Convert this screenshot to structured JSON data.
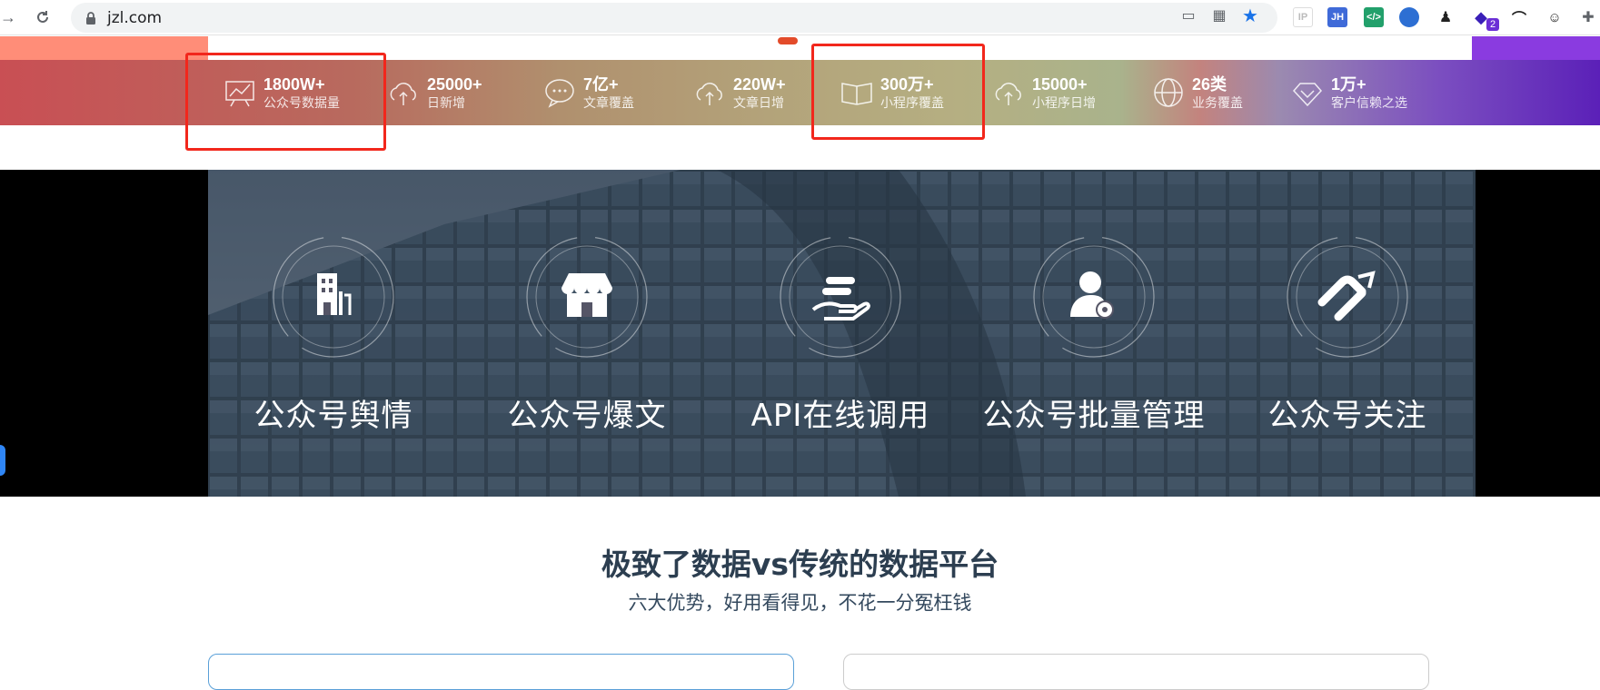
{
  "browser": {
    "url": "jzl.com",
    "extension_badge": "2",
    "extensions": [
      "IP",
      "JH"
    ]
  },
  "stats": [
    {
      "num": "1800W+",
      "label": "公众号数据量"
    },
    {
      "num": "25000+",
      "label": "日新增"
    },
    {
      "num": "7亿+",
      "label": "文章覆盖"
    },
    {
      "num": "220W+",
      "label": "文章日增"
    },
    {
      "num": "300万+",
      "label": "小程序覆盖"
    },
    {
      "num": "15000+",
      "label": "小程序日增"
    },
    {
      "num": "26类",
      "label": "业务覆盖"
    },
    {
      "num": "1万+",
      "label": "客户信赖之选"
    }
  ],
  "services": [
    {
      "title": "公众号舆情",
      "icon": "building-icon"
    },
    {
      "title": "公众号爆文",
      "icon": "store-icon"
    },
    {
      "title": "API在线调用",
      "icon": "hand-coins-icon"
    },
    {
      "title": "公众号批量管理",
      "icon": "user-gear-icon"
    },
    {
      "title": "公众号关注",
      "icon": "handshake-icon"
    }
  ],
  "section": {
    "title": "极致了数据vs传统的数据平台",
    "subtitle": "六大优势，好用看得见，不花一分冤枉钱"
  },
  "colors": {
    "highlight_box": "#f2271c",
    "accent_blue": "#2f86f6"
  }
}
